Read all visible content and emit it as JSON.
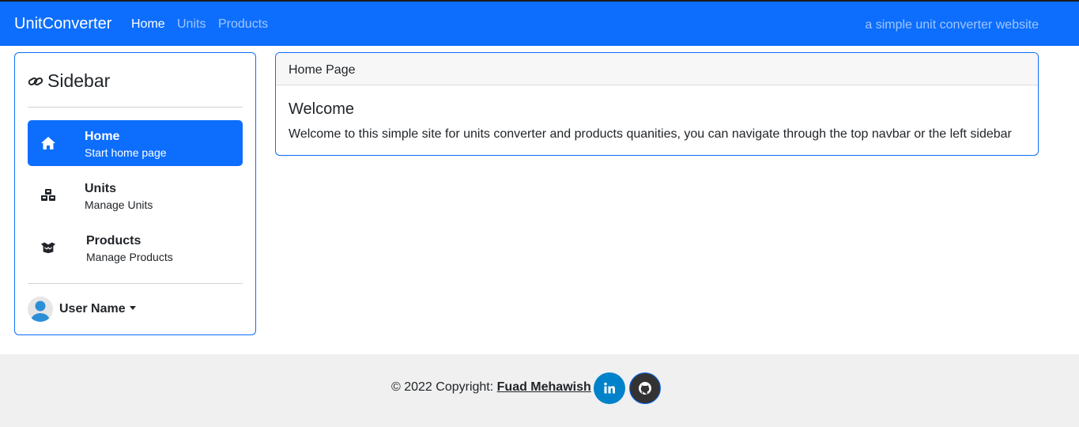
{
  "navbar": {
    "brand": "UnitConverter",
    "links": [
      {
        "label": "Home",
        "active": true
      },
      {
        "label": "Units",
        "active": false
      },
      {
        "label": "Products",
        "active": false
      }
    ],
    "tagline": "a simple unit converter website",
    "color": "#0d6efd"
  },
  "sidebar": {
    "title": "Sidebar",
    "title_icon": "link-icon",
    "items": [
      {
        "label": "Home",
        "sublabel": "Start home page",
        "icon": "home-icon",
        "active": true
      },
      {
        "label": "Units",
        "sublabel": "Manage Units",
        "icon": "cubes-icon",
        "active": false
      },
      {
        "label": "Products",
        "sublabel": "Manage Products",
        "icon": "box-open-icon",
        "active": false
      }
    ],
    "user": {
      "name": "User Name",
      "icon": "avatar-icon"
    }
  },
  "main": {
    "card_header": "Home Page",
    "title": "Welcome",
    "text": "Welcome to this simple site for units converter and products quanities, you can navigate through the top navbar or the left sidebar"
  },
  "footer": {
    "copyright": "© 2022 Copyright: ",
    "author": "Fuad Mehawish",
    "social": [
      {
        "icon": "linkedin-icon",
        "color": "#0082ca"
      },
      {
        "icon": "github-icon",
        "color": "#333333"
      }
    ]
  }
}
